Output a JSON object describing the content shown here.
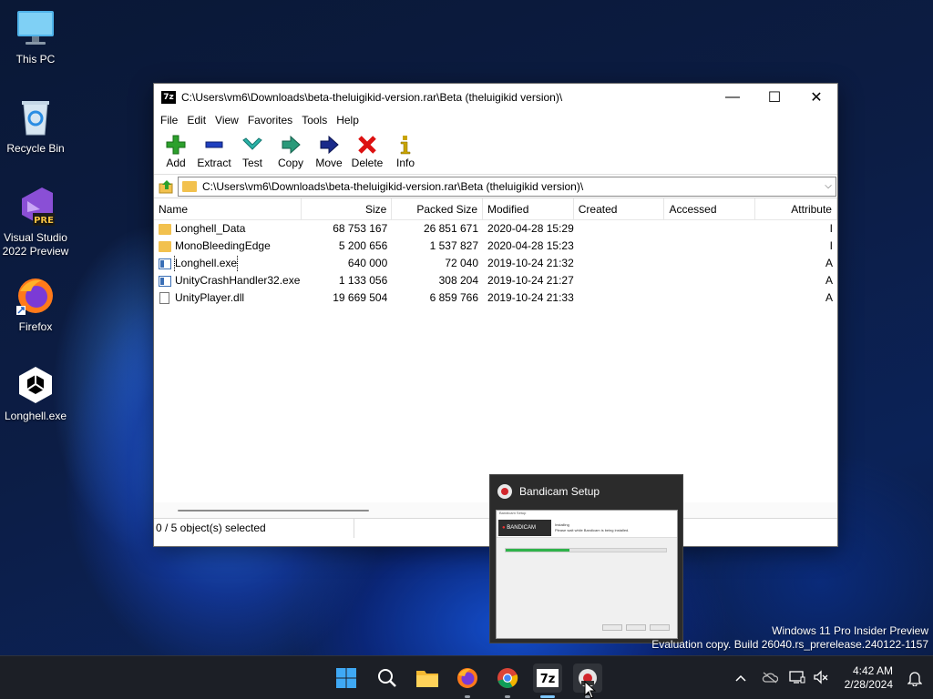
{
  "desktop": {
    "icons": [
      {
        "label": "This PC",
        "icon": "computer-icon"
      },
      {
        "label": "Recycle Bin",
        "icon": "recycle-bin-icon"
      },
      {
        "label": "Visual Studio 2022 Preview",
        "icon": "visual-studio-icon",
        "badge": "PRE"
      },
      {
        "label": "Firefox",
        "icon": "firefox-icon"
      },
      {
        "label": "Longhell.exe",
        "icon": "unity-icon"
      }
    ]
  },
  "window": {
    "app_icon_text": "7z",
    "title": "C:\\Users\\vm6\\Downloads\\beta-theluigikid-version.rar\\Beta (theluigikid version)\\",
    "controls": {
      "minimize": "—",
      "maximize": "☐",
      "close": "✕"
    },
    "menu": [
      "File",
      "Edit",
      "View",
      "Favorites",
      "Tools",
      "Help"
    ],
    "toolbar": [
      {
        "label": "Add",
        "icon": "add-icon",
        "color": "#2ca02c"
      },
      {
        "label": "Extract",
        "icon": "extract-icon",
        "color": "#1f3fbf"
      },
      {
        "label": "Test",
        "icon": "test-icon",
        "color": "#2bb3a8"
      },
      {
        "label": "Copy",
        "icon": "copy-icon",
        "color": "#2a9a7a"
      },
      {
        "label": "Move",
        "icon": "move-icon",
        "color": "#1a2a8a"
      },
      {
        "label": "Delete",
        "icon": "delete-icon",
        "color": "#d11"
      },
      {
        "label": "Info",
        "icon": "info-icon",
        "color": "#c9a400"
      }
    ],
    "address": "C:\\Users\\vm6\\Downloads\\beta-theluigikid-version.rar\\Beta (theluigikid version)\\",
    "columns": [
      "Name",
      "Size",
      "Packed Size",
      "Modified",
      "Created",
      "Accessed",
      "Attribute"
    ],
    "files": [
      {
        "name": "Longhell_Data",
        "type": "folder",
        "size": "68 753 167",
        "packed": "26 851 671",
        "modified": "2020-04-28 15:29",
        "created": "",
        "accessed": "",
        "attr": "I"
      },
      {
        "name": "MonoBleedingEdge",
        "type": "folder",
        "size": "5 200 656",
        "packed": "1 537 827",
        "modified": "2020-04-28 15:23",
        "created": "",
        "accessed": "",
        "attr": "I"
      },
      {
        "name": "Longhell.exe",
        "type": "exe",
        "size": "640 000",
        "packed": "72 040",
        "modified": "2019-10-24 21:32",
        "created": "",
        "accessed": "",
        "attr": "A"
      },
      {
        "name": "UnityCrashHandler32.exe",
        "type": "exe",
        "size": "1 133 056",
        "packed": "308 204",
        "modified": "2019-10-24 21:27",
        "created": "",
        "accessed": "",
        "attr": "A"
      },
      {
        "name": "UnityPlayer.dll",
        "type": "dll",
        "size": "19 669 504",
        "packed": "6 859 766",
        "modified": "2019-10-24 21:33",
        "created": "",
        "accessed": "",
        "attr": "A"
      }
    ],
    "status": "0 / 5 object(s) selected"
  },
  "thumbnail": {
    "title": "Bandicam Setup",
    "preview_window_title": "Bandicam Setup",
    "preview_logo": "BANDICAM",
    "preview_heading": "Installing",
    "preview_text": "Please wait while Bandicam is being installed.",
    "progress": 0.4
  },
  "watermark": {
    "line1": "Windows 11 Pro Insider Preview",
    "line2": "Evaluation copy. Build 26040.rs_prerelease.240122-1157"
  },
  "taskbar": {
    "apps": [
      "start-icon",
      "search-icon",
      "file-explorer-icon",
      "firefox-icon",
      "chrome-icon",
      "7zip-icon",
      "bandicam-icon"
    ],
    "time": "4:42 AM",
    "date": "2/28/2024"
  }
}
